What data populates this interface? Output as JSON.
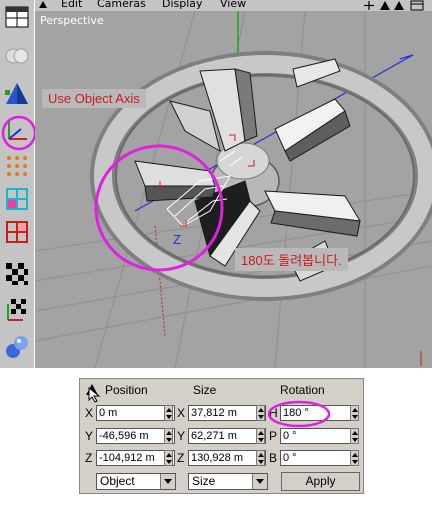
{
  "menu": {
    "items": [
      "Edit",
      "Cameras",
      "Display",
      "View"
    ]
  },
  "viewport": {
    "title": "Perspective",
    "axis_label": "Z"
  },
  "annotations": {
    "use_object_axis": "Use Object Axis",
    "rotate_note": "180도 돌려봅니다."
  },
  "coord_panel": {
    "headers": {
      "position": "Position",
      "size": "Size",
      "rotation": "Rotation"
    },
    "rows": [
      {
        "pos_axis": "X",
        "pos_value": "0 m",
        "size_axis": "X",
        "size_value": "37,812 m",
        "rot_axis": "H",
        "rot_value": "180 °"
      },
      {
        "pos_axis": "Y",
        "pos_value": "-46,596 m",
        "size_axis": "Y",
        "size_value": "62,271 m",
        "rot_axis": "P",
        "rot_value": "0 °"
      },
      {
        "pos_axis": "Z",
        "pos_value": "-104,912 m",
        "size_axis": "Z",
        "size_value": "130,928 m",
        "rot_axis": "B",
        "rot_value": "0 °"
      }
    ],
    "coord_mode": "Object",
    "size_mode": "Size",
    "apply_label": "Apply"
  },
  "colors": {
    "highlight_circle": "#e020e0",
    "note_text": "#c81e1e",
    "viewport_bg": "#a3a3a3"
  }
}
